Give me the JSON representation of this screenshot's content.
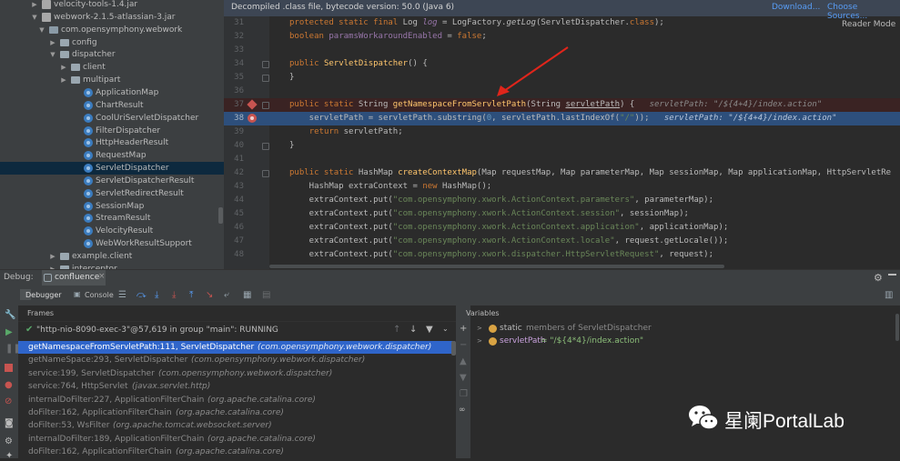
{
  "project_tree": {
    "rows": [
      {
        "label": "velocity-tools-1.4.jar",
        "type": "jar",
        "arrow": "▶"
      },
      {
        "label": "webwork-2.1.5-atlassian-3.jar",
        "type": "jar",
        "arrow": "▼"
      },
      {
        "label": "com.opensymphony.webwork",
        "type": "package",
        "arrow": "▼"
      },
      {
        "label": "config",
        "type": "folder",
        "arrow": "▶"
      },
      {
        "label": "dispatcher",
        "type": "folder",
        "arrow": "▼"
      },
      {
        "label": "client",
        "type": "folder",
        "arrow": "▶"
      },
      {
        "label": "multipart",
        "type": "folder",
        "arrow": "▶"
      },
      {
        "label": "ApplicationMap",
        "type": "class",
        "arrow": ""
      },
      {
        "label": "ChartResult",
        "type": "class",
        "arrow": ""
      },
      {
        "label": "CoolUriServletDispatcher",
        "type": "class",
        "arrow": ""
      },
      {
        "label": "FilterDispatcher",
        "type": "class",
        "arrow": ""
      },
      {
        "label": "HttpHeaderResult",
        "type": "class",
        "arrow": ""
      },
      {
        "label": "RequestMap",
        "type": "class",
        "arrow": ""
      },
      {
        "label": "ServletDispatcher",
        "type": "class",
        "arrow": "",
        "selected": true
      },
      {
        "label": "ServletDispatcherResult",
        "type": "class",
        "arrow": ""
      },
      {
        "label": "ServletRedirectResult",
        "type": "class",
        "arrow": ""
      },
      {
        "label": "SessionMap",
        "type": "class",
        "arrow": ""
      },
      {
        "label": "StreamResult",
        "type": "class",
        "arrow": ""
      },
      {
        "label": "VelocityResult",
        "type": "class",
        "arrow": ""
      },
      {
        "label": "WebWorkResultSupport",
        "type": "class",
        "arrow": ""
      },
      {
        "label": "example.client",
        "type": "folder",
        "arrow": "▶"
      },
      {
        "label": "interceptor",
        "type": "folder",
        "arrow": "▶"
      }
    ]
  },
  "editor": {
    "banner": "Decompiled .class file, bytecode version: 50.0 (Java 6)",
    "download_label": "Download...",
    "choose_sources_label": "Choose Sources...",
    "reader_mode_label": "Reader Mode",
    "line_numbers": [
      "31",
      "32",
      "33",
      "34",
      "35",
      "36",
      "37",
      "38",
      "39",
      "40",
      "41",
      "42",
      "43",
      "44",
      "45",
      "46",
      "47",
      "48"
    ]
  },
  "debug": {
    "label": "Debug:",
    "session_tab": "confluence",
    "debugger_tab": "Debugger",
    "console_tab": "Console",
    "frames_title": "Frames",
    "variables_title": "Variables",
    "thread_status": "\"http-nio-8090-exec-3\"@57,619 in group \"main\": RUNNING",
    "frames": [
      {
        "method": "getNamespaceFromServletPath:111, ServletDispatcher",
        "pkg": "(com.opensymphony.webwork.dispatcher)",
        "selected": true
      },
      {
        "method": "getNameSpace:293, ServletDispatcher",
        "pkg": "(com.opensymphony.webwork.dispatcher)"
      },
      {
        "method": "service:199, ServletDispatcher",
        "pkg": "(com.opensymphony.webwork.dispatcher)"
      },
      {
        "method": "service:764, HttpServlet",
        "pkg": "(javax.servlet.http)"
      },
      {
        "method": "internalDoFilter:227, ApplicationFilterChain",
        "pkg": "(org.apache.catalina.core)"
      },
      {
        "method": "doFilter:162, ApplicationFilterChain",
        "pkg": "(org.apache.catalina.core)"
      },
      {
        "method": "doFilter:53, WsFilter",
        "pkg": "(org.apache.tomcat.websocket.server)"
      },
      {
        "method": "internalDoFilter:189, ApplicationFilterChain",
        "pkg": "(org.apache.catalina.core)"
      },
      {
        "method": "doFilter:162, ApplicationFilterChain",
        "pkg": "(org.apache.catalina.core)"
      }
    ],
    "variables": [
      {
        "name": "static",
        "value": "members of ServletDispatcher"
      },
      {
        "name": "servletPath",
        "value": "= \"/${4*4}/index.action\""
      }
    ]
  },
  "watermark": {
    "text": "星阑PortalLab"
  }
}
